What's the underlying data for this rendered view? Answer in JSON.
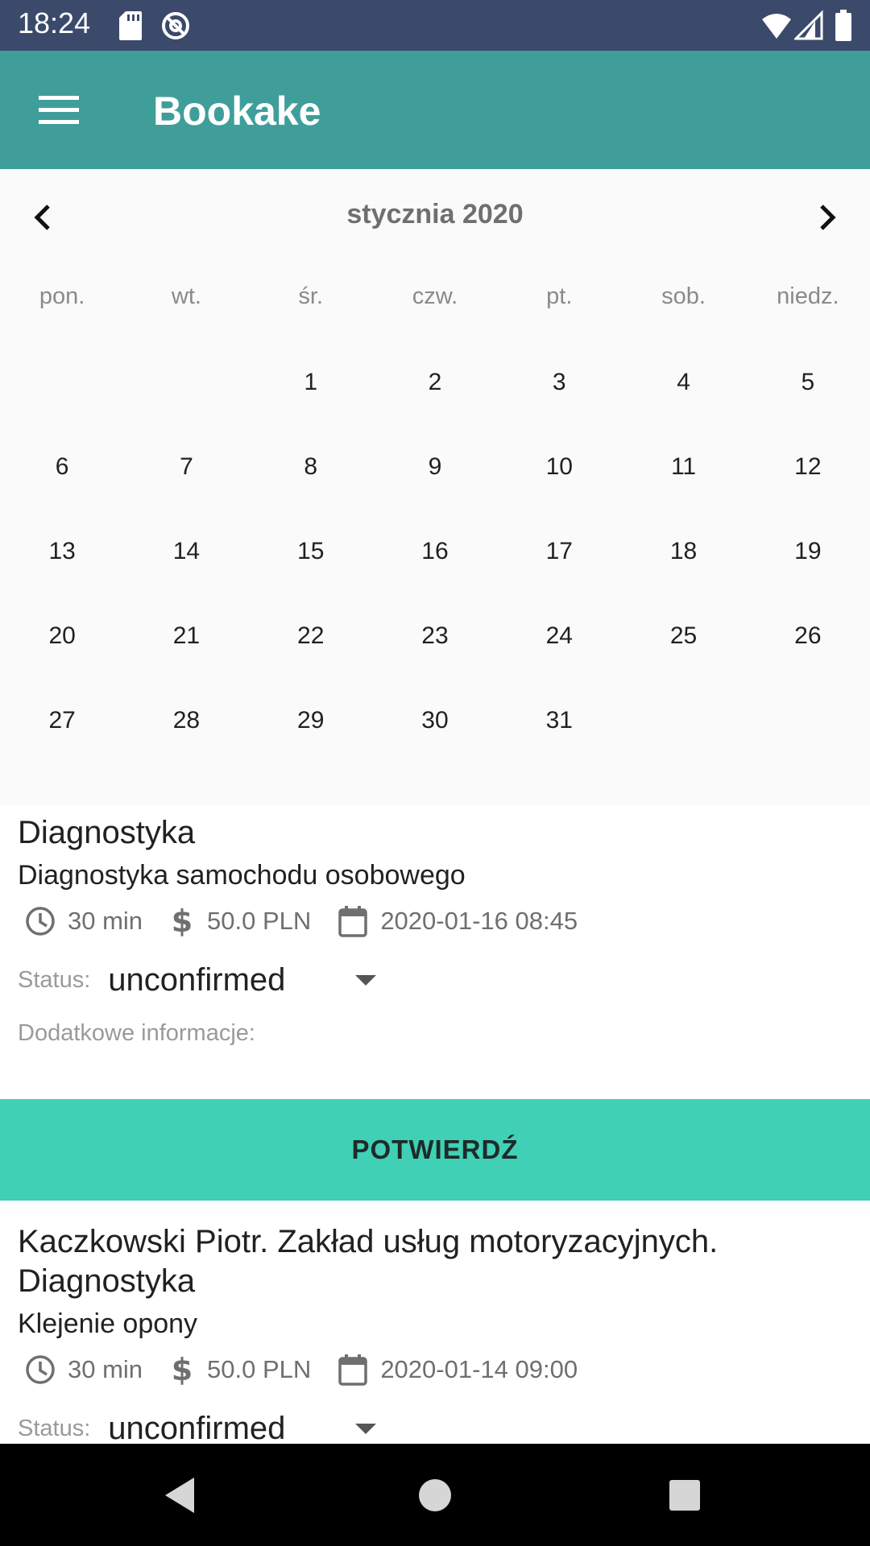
{
  "status_bar": {
    "time": "18:24"
  },
  "app_bar": {
    "title": "Bookake"
  },
  "calendar": {
    "month_label": "stycznia 2020",
    "weekdays": [
      "pon.",
      "wt.",
      "śr.",
      "czw.",
      "pt.",
      "sob.",
      "niedz."
    ],
    "weeks": [
      [
        "",
        "",
        "1",
        "2",
        "3",
        "4",
        "5"
      ],
      [
        "6",
        "7",
        "8",
        "9",
        "10",
        "11",
        "12"
      ],
      [
        "13",
        "14",
        "15",
        "16",
        "17",
        "18",
        "19"
      ],
      [
        "20",
        "21",
        "22",
        "23",
        "24",
        "25",
        "26"
      ],
      [
        "27",
        "28",
        "29",
        "30",
        "31",
        "",
        ""
      ]
    ]
  },
  "bookings": [
    {
      "title_line2": "Diagnostyka",
      "service": "Diagnostyka samochodu osobowego",
      "duration": "30 min",
      "price": "50.0 PLN",
      "datetime": "2020-01-16 08:45",
      "status_label": "Status:",
      "status_value": "unconfirmed",
      "info_label": "Dodatkowe informacje:",
      "confirm_label": "POTWIERDŹ"
    },
    {
      "title": "Kaczkowski Piotr. Zakład usług motoryzacyjnych. Diagnostyka",
      "service": "Klejenie opony",
      "duration": "30 min",
      "price": "50.0 PLN",
      "datetime": "2020-01-14 09:00",
      "status_label": "Status:",
      "status_value": "unconfirmed"
    }
  ]
}
